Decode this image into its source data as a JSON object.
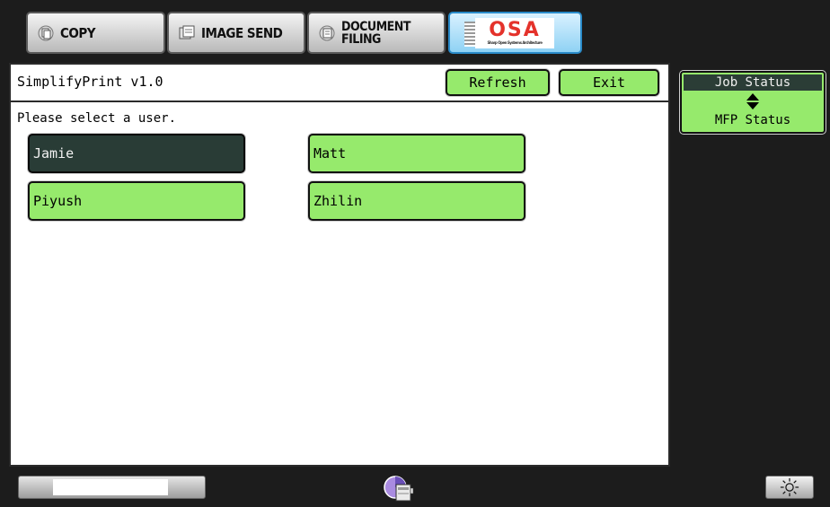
{
  "tabs": {
    "copy": "COPY",
    "image_send": "IMAGE SEND",
    "filing_line1": "DOCUMENT",
    "filing_line2": "FILING",
    "osa_logo": "OSA",
    "osa_tagline": "Sharp Open Systems Architecture"
  },
  "app": {
    "title": "SimplifyPrint v1.0",
    "refresh_label": "Refresh",
    "exit_label": "Exit",
    "prompt": "Please select a user."
  },
  "users": [
    {
      "name": "Jamie",
      "selected": true
    },
    {
      "name": "Matt",
      "selected": false
    },
    {
      "name": "Piyush",
      "selected": false
    },
    {
      "name": "Zhilin",
      "selected": false
    }
  ],
  "status": {
    "job_label": "Job Status",
    "mfp_label": "MFP Status"
  },
  "colors": {
    "button_green": "#96ea6c",
    "selected_dark": "#293c36",
    "background_dark": "#1c1c1c",
    "osa_red": "#e4322b",
    "osa_tab_blue": "#8fd2f4"
  },
  "icons": [
    "copy-icon",
    "image-send-icon",
    "document-filing-icon",
    "osa-logo",
    "up-down-arrows-icon",
    "machine-status-icon",
    "brightness-icon"
  ]
}
